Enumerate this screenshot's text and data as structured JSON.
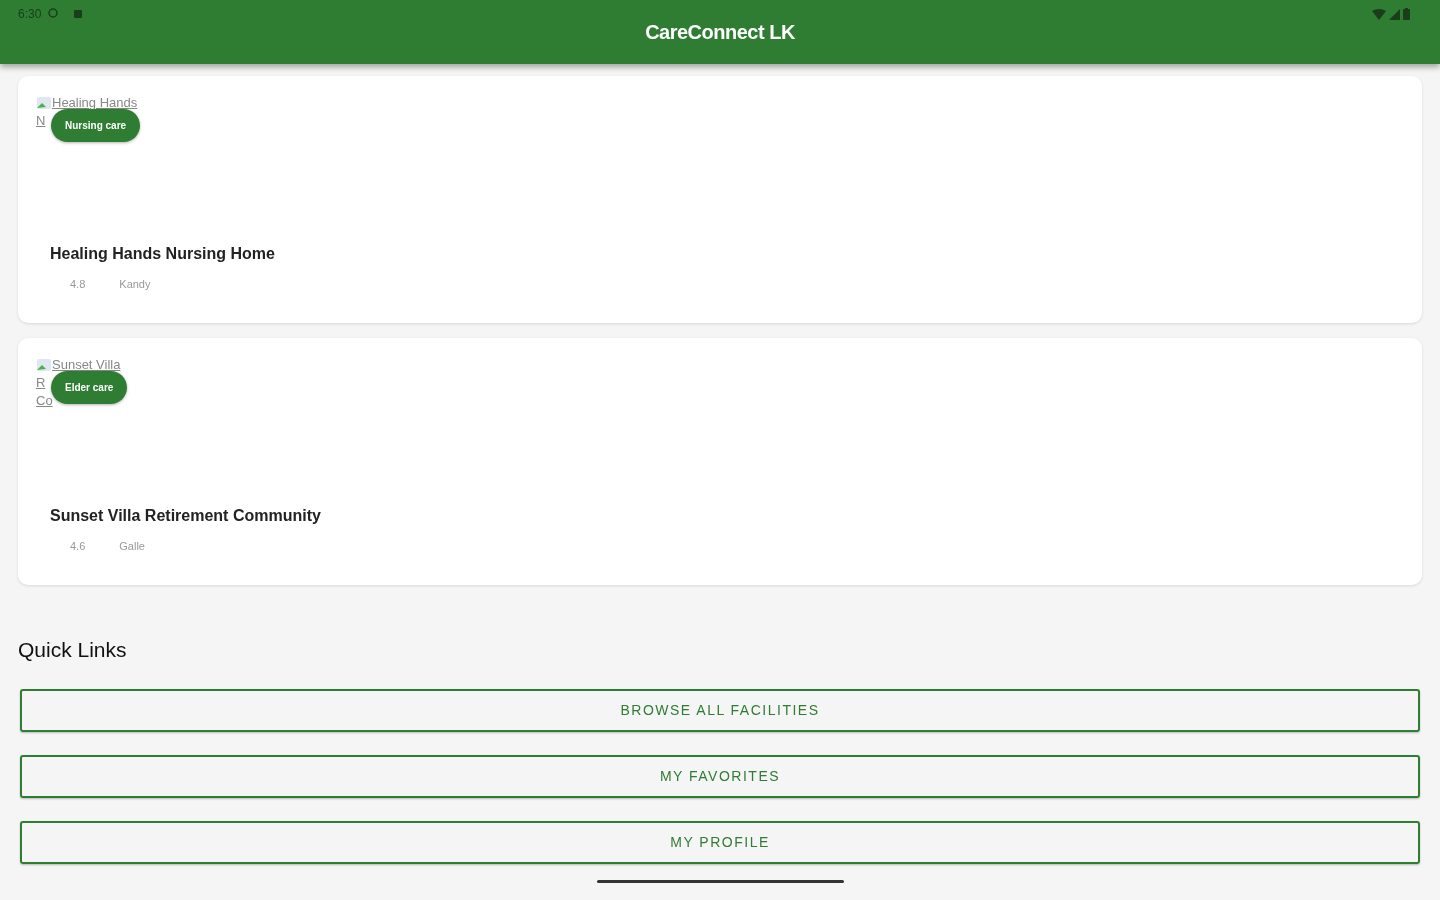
{
  "status_bar": {
    "time": "6:30"
  },
  "app_bar": {
    "title": "CareConnect LK"
  },
  "facilities": [
    {
      "image_alt": [
        "Healing Hands",
        "N"
      ],
      "badge": "Nursing care",
      "name": "Healing Hands Nursing Home",
      "rating": "4.8",
      "location": "Kandy"
    },
    {
      "image_alt": [
        "Sunset Villa",
        "R",
        "Co"
      ],
      "badge": "Elder care",
      "name": "Sunset Villa Retirement Community",
      "rating": "4.6",
      "location": "Galle"
    }
  ],
  "quick_links": {
    "title": "Quick Links",
    "buttons": [
      "BROWSE ALL FACILITIES",
      "MY FAVORITES",
      "MY PROFILE"
    ]
  }
}
